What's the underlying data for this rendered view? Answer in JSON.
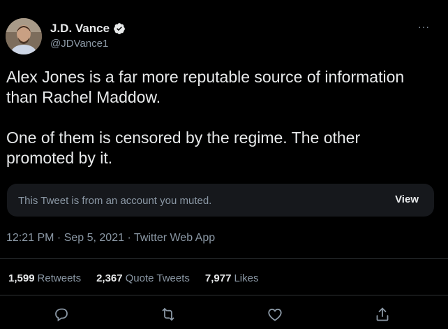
{
  "author": {
    "name": "J.D. Vance",
    "handle": "@JDVance1",
    "verified": true
  },
  "tweet": {
    "text": "Alex Jones is a far more reputable source of information than Rachel Maddow.\n\nOne of them is censored by the regime. The other promoted by it."
  },
  "muted_notice": {
    "text": "This Tweet is from an account you muted.",
    "view_label": "View"
  },
  "meta": {
    "timestamp": "12:21 PM · Sep 5, 2021 · Twitter Web App"
  },
  "stats": {
    "retweets_count": "1,599",
    "retweets_label": "Retweets",
    "quotes_count": "2,367",
    "quotes_label": "Quote Tweets",
    "likes_count": "7,977",
    "likes_label": "Likes"
  },
  "menu": {
    "more": "···"
  },
  "icons": {
    "reply": "reply-icon",
    "retweet": "retweet-icon",
    "like": "like-icon",
    "share": "share-icon",
    "more": "more-icon",
    "verified": "verified-badge-icon"
  },
  "colors": {
    "background": "#000000",
    "primary_text": "#e7e9ea",
    "secondary_text": "#8b98a5",
    "muted_box": "#16181c"
  }
}
